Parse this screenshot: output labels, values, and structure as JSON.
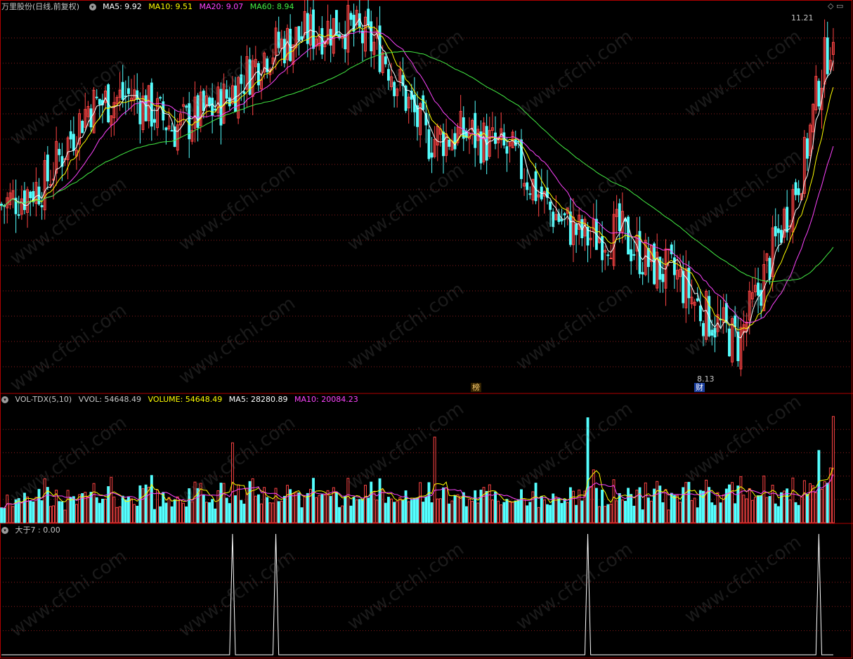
{
  "header_main": {
    "title": "万里股份(日线,前复权)",
    "ma5": "MA5: 9.92",
    "ma10": "MA10: 9.51",
    "ma20": "MA20: 9.07",
    "ma60": "MA60: 8.94"
  },
  "header_vol": {
    "title": "VOL-TDX(5,10)",
    "vvol": "VVOL: 54648.49",
    "volume": "VOLUME: 54648.49",
    "ma5": "MA5: 28280.89",
    "ma10": "MA10: 20084.23"
  },
  "header_ind": {
    "title": "大于7 : 0.00"
  },
  "annotations": {
    "high": "11.21",
    "low": "8.13",
    "tag_bang": "榜",
    "tag_cai": "财"
  },
  "watermark": "www.cfchi.com",
  "colors": {
    "up": "#ff4444",
    "down": "#54ffff",
    "ma5": "#ffffff",
    "ma10": "#ffff00",
    "ma20": "#ff44ff",
    "ma60": "#44ee44",
    "grid": "#8a1c1c",
    "frame": "#b00000"
  },
  "chart_data": [
    {
      "type": "candlestick",
      "name": "price",
      "ylim": [
        7.9,
        11.35
      ],
      "anchors": [
        [
          0,
          9.6
        ],
        [
          15,
          9.8
        ],
        [
          30,
          10.5
        ],
        [
          45,
          10.6
        ],
        [
          60,
          10.3
        ],
        [
          75,
          10.5
        ],
        [
          92,
          11.0
        ],
        [
          105,
          11.15
        ],
        [
          118,
          11.25
        ],
        [
          132,
          11.0
        ],
        [
          147,
          10.2
        ],
        [
          162,
          10.25
        ],
        [
          177,
          10.05
        ],
        [
          190,
          9.55
        ],
        [
          202,
          9.3
        ],
        [
          214,
          9.35
        ],
        [
          225,
          9.05
        ],
        [
          234,
          8.95
        ],
        [
          242,
          8.65
        ],
        [
          255,
          8.35
        ],
        [
          262,
          8.8
        ],
        [
          270,
          9.4
        ],
        [
          278,
          10.0
        ],
        [
          283,
          10.7
        ],
        [
          288,
          11.21
        ]
      ],
      "note": "Daily candles reconstructed from overall price path; MA5/MA10/MA20/MA60 overlays"
    },
    {
      "type": "bar",
      "name": "volume",
      "ylim": [
        0,
        60000
      ],
      "last_volume": 54648.49,
      "ma5_last": 28280.89,
      "ma10_last": 20084.23
    },
    {
      "type": "line",
      "name": "大于7",
      "ylim": [
        0,
        1
      ],
      "spike_index": [
        80,
        95,
        203,
        283
      ],
      "last_value": 0.0
    }
  ]
}
